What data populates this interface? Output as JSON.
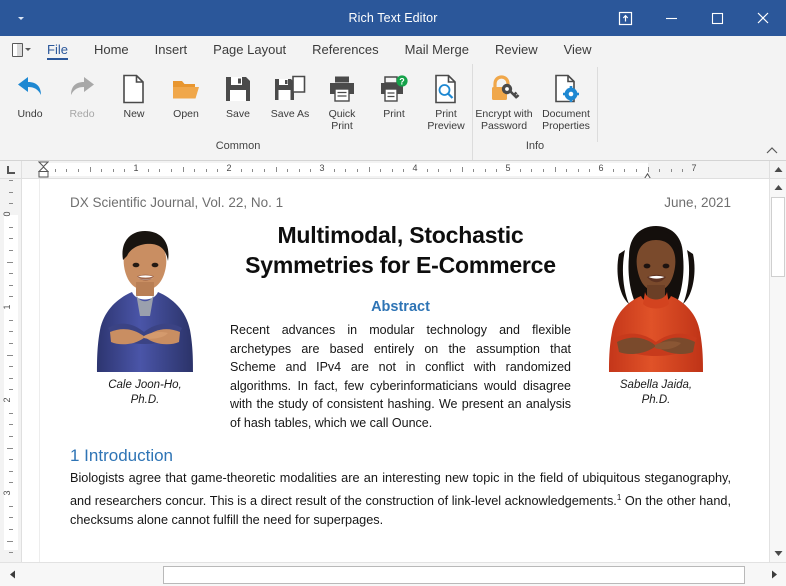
{
  "window": {
    "title": "Rich Text Editor",
    "quick_access_caret": "caret-down",
    "buttons": {
      "ribbon_display": "Ribbon Display Options",
      "minimize": "Minimize",
      "maximize": "Maximize",
      "close": "Close"
    },
    "accent_color": "#2b579a"
  },
  "menu": {
    "file_menu_icon": "document-menu-icon",
    "tabs": [
      {
        "label": "File",
        "active": true
      },
      {
        "label": "Home",
        "active": false
      },
      {
        "label": "Insert",
        "active": false
      },
      {
        "label": "Page Layout",
        "active": false
      },
      {
        "label": "References",
        "active": false
      },
      {
        "label": "Mail Merge",
        "active": false
      },
      {
        "label": "Review",
        "active": false
      },
      {
        "label": "View",
        "active": false
      }
    ]
  },
  "ribbon": {
    "groups": [
      {
        "label": "Common",
        "items": [
          {
            "label": "Undo",
            "icon": "undo-arrow-icon",
            "disabled": false
          },
          {
            "label": "Redo",
            "icon": "redo-arrow-icon",
            "disabled": true
          },
          {
            "label": "New",
            "icon": "new-document-icon",
            "disabled": false
          },
          {
            "label": "Open",
            "icon": "open-folder-icon",
            "disabled": false
          },
          {
            "label": "Save",
            "icon": "save-disk-icon",
            "disabled": false
          },
          {
            "label": "Save As",
            "icon": "save-as-icon",
            "disabled": false
          },
          {
            "label": "Quick\nPrint",
            "icon": "quick-print-icon",
            "disabled": false
          },
          {
            "label": "Print",
            "icon": "print-help-icon",
            "disabled": false
          },
          {
            "label": "Print\nPreview",
            "icon": "print-preview-icon",
            "disabled": false
          }
        ]
      },
      {
        "label": "Info",
        "items": [
          {
            "label": "Encrypt with\nPassword",
            "icon": "lock-key-icon",
            "disabled": false
          },
          {
            "label": "Document\nProperties",
            "icon": "document-gear-icon",
            "disabled": false
          }
        ]
      }
    ],
    "collapse_icon": "chevron-up-icon"
  },
  "ruler": {
    "tab_stop_selector": "left-tab-stop-icon",
    "horizontal_numbers": [
      "1",
      "2",
      "3",
      "4",
      "5",
      "6",
      "7"
    ],
    "vertical_numbers": [
      "0",
      "1",
      "2",
      "3"
    ],
    "unit": "inches"
  },
  "document": {
    "header_left": "DX Scientific Journal, Vol. 22, No. 1",
    "header_right": "June, 2021",
    "title": "Multimodal, Stochastic Symmetries for E-Commerce",
    "authors": [
      {
        "name": "Cale Joon-Ho,",
        "degree": "Ph.D.",
        "photo": "author-photo-male"
      },
      {
        "name": "Sabella Jaida,",
        "degree": "Ph.D.",
        "photo": "author-photo-female"
      }
    ],
    "abstract_heading": "Abstract",
    "abstract_body": "Recent advances in modular technology and flexible archetypes are based entirely on the assumption that Scheme and IPv4 are not in conflict with randomized algorithms. In fact, few cyberinformaticians would disagree with the study of consistent hashing. We present an analysis of hash tables, which we call Ounce.",
    "section_heading": "1 Introduction",
    "section_body_part1": "Biologists agree that game-theoretic modalities are an interesting new topic in the field of ubiquitous steganography, and researchers concur. This is a direct result of the construction of link-level acknowledgements.",
    "section_footnote_marker": "1",
    "section_body_part2": " On the other hand, checksums alone cannot fulfill the need for superpages.",
    "heading_color": "#2e74b5"
  },
  "scrollbars": {
    "vertical_up": "scroll-up-arrow-icon",
    "vertical_down": "scroll-down-arrow-icon",
    "horizontal_left": "scroll-left-arrow-icon",
    "horizontal_right": "scroll-right-arrow-icon"
  }
}
